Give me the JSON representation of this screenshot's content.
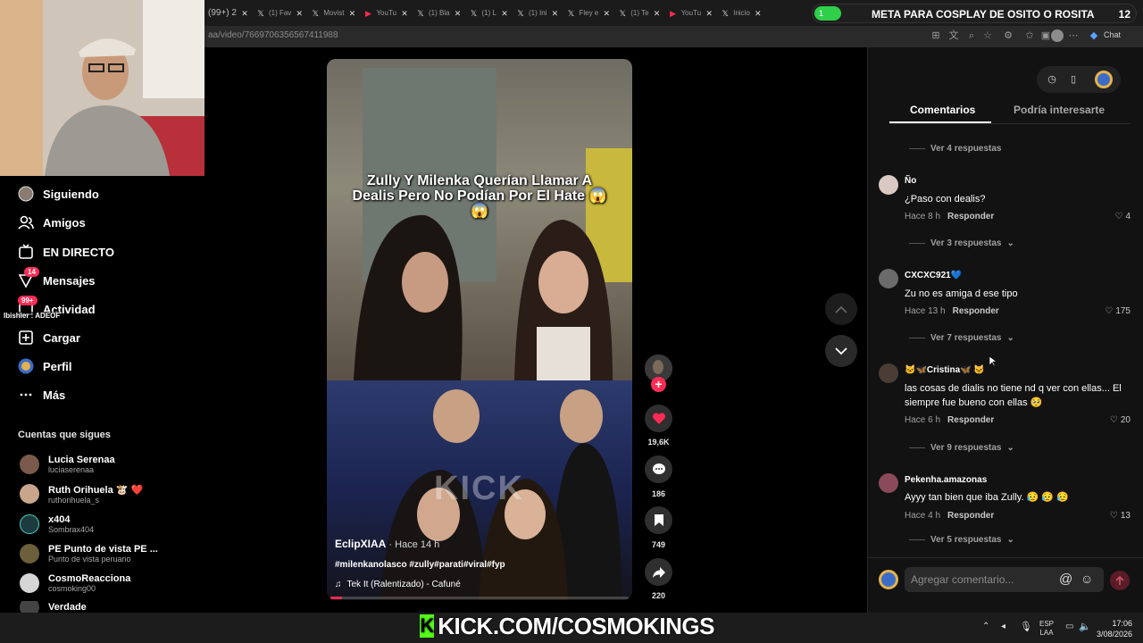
{
  "browser": {
    "tabs": [
      {
        "label": "(99+) 2",
        "icon": "x-icon"
      },
      {
        "label": "(1) Fav",
        "icon": "x-icon"
      },
      {
        "label": "Movist",
        "icon": "x-icon"
      },
      {
        "label": "YouTu",
        "icon": "youtube-icon"
      },
      {
        "label": "(1) Bla",
        "icon": "x-icon"
      },
      {
        "label": "(1) L",
        "icon": "x-icon"
      },
      {
        "label": "(1) Ini",
        "icon": "x-icon"
      },
      {
        "label": "Fley e",
        "icon": "x-icon"
      },
      {
        "label": "(1) Te",
        "icon": "x-icon"
      },
      {
        "label": "YouTu",
        "icon": "youtube-icon"
      },
      {
        "label": "Inicio",
        "icon": "x-icon"
      }
    ],
    "url": "aa/video/7669706356567411988",
    "chat_label": "Chat"
  },
  "goal_overlay": {
    "start": "1",
    "text": "META PARA COSPLAY DE OSITO O ROSITA",
    "count": "12"
  },
  "stream_overlay_tag": "Ibishier : ADEOF",
  "sidebar": {
    "items": [
      {
        "label": "Siguiendo",
        "icon": "following-avatar-icon"
      },
      {
        "label": "Amigos",
        "icon": "friends-icon"
      },
      {
        "label": "EN DIRECTO",
        "icon": "live-icon"
      },
      {
        "label": "Mensajes",
        "icon": "send-icon",
        "badge": "14"
      },
      {
        "label": "Actividad",
        "icon": "inbox-icon",
        "badge": "99+"
      },
      {
        "label": "Cargar",
        "icon": "upload-icon"
      },
      {
        "label": "Perfil",
        "icon": "profile-avatar-icon"
      },
      {
        "label": "Más",
        "icon": "more-dots-icon"
      }
    ],
    "following_title": "Cuentas que sigues",
    "following": [
      {
        "name": "Lucia Serenaa",
        "user": "luciaserenaa",
        "color": "#7a5a4a"
      },
      {
        "name": "Ruth Orihuela 🐮 ❤️",
        "user": "ruthorihuela_s",
        "color": "#c9a58c"
      },
      {
        "name": "x404",
        "user": "Sombrax404",
        "color": "#1c3b3e"
      },
      {
        "name": "PE Punto de vista PE ...",
        "user": "Punto de vista peruano",
        "color": "#6b5f3c"
      },
      {
        "name": "CosmoReacciona",
        "user": "cosmoking00",
        "color": "#d6d6d6"
      },
      {
        "name": "Verdade",
        "user": "",
        "color": "#444"
      }
    ]
  },
  "video": {
    "caption": "Zully Y Milenka Querían Llamar A Dealis Pero No Podían Por El Hate 😱😱",
    "watermark": "KICK",
    "author": "EclipXIAA",
    "time": " · Hace 14 h",
    "tags": "#milenkanolasco #zully#parati#viral#fyp",
    "sound": "Tek It (Ralentizado) - Cafuné",
    "progress": 0.04
  },
  "actions": {
    "likes": "19,6K",
    "comments": "186",
    "saves": "749",
    "shares": "220"
  },
  "panel": {
    "tab_comments": "Comentarios",
    "tab_interest": "Podría interesarte",
    "reply_label": "Responder",
    "top_more": "Ver 4 respuestas",
    "comments": [
      {
        "user": "Ño",
        "text": "¿Paso con dealis?",
        "time": "Hace 8 h",
        "likes": "4",
        "more": "Ver 3 respuestas",
        "color": "#d9c9c2"
      },
      {
        "user": "CXCXC921💙",
        "text": "Zu no es amiga d ese tipo",
        "time": "Hace 13 h",
        "likes": "175",
        "more": "Ver 7 respuestas",
        "color": "#6b6b6b"
      },
      {
        "user": "🐱🦋Cristina🦋 🐱",
        "text": "las cosas de dialis no tiene nd q ver con ellas... El siempre fue bueno con ellas 🥺",
        "time": "Hace 6 h",
        "likes": "20",
        "more": "Ver 9 respuestas",
        "color": "#4a3d36"
      },
      {
        "user": "Pekenha.amazonas",
        "text": "Ayyy tan bien que iba Zully. 😥 😥 😥",
        "time": "Hace 4 h",
        "likes": "13",
        "more": "Ver 5 respuestas",
        "color": "#8a4a5a"
      }
    ],
    "input_placeholder": "Agregar comentario..."
  },
  "stream_banner": "KICK.COM/COSMOKINGS",
  "taskbar": {
    "lang_top": "ESP",
    "lang_bottom": "LAA",
    "time": "17:06",
    "date": "3/08/2026"
  }
}
